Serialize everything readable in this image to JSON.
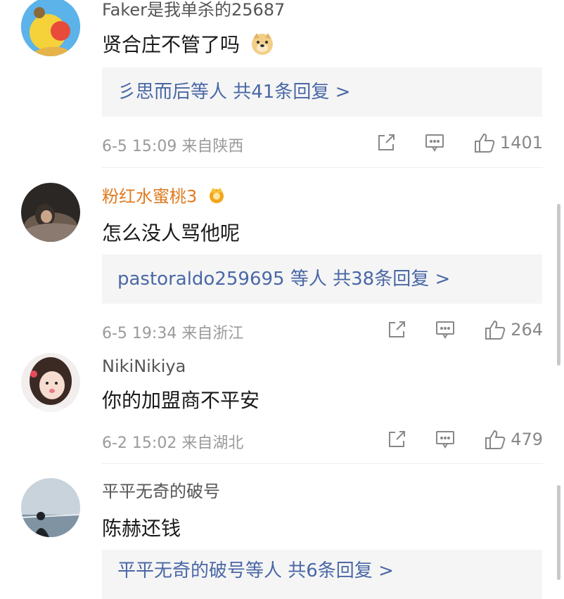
{
  "comments": [
    {
      "username": "Faker是我单杀的25687",
      "text": "贤合庄不管了吗",
      "emoji_icon": "doge-face-icon",
      "replies_label": "彡思而后等人 共41条回复 >",
      "time": "6-5 15:09",
      "location": "来自陕西",
      "likes": "1401"
    },
    {
      "username": "粉红水蜜桃3",
      "badge_icon": "crown-badge-icon",
      "text": "怎么没人骂他呢",
      "replies_label": "pastoraldo259695 等人 共38条回复 >",
      "time": "6-5 19:34",
      "location": "来自浙江",
      "likes": "264"
    },
    {
      "username": "NikiNikiya",
      "text": "你的加盟商不平安",
      "time": "6-2 15:02",
      "location": "来自湖北",
      "likes": "479"
    },
    {
      "username": "平平无奇的破号",
      "text": "陈赫还钱",
      "replies_label": "平平无奇的破号等人 共6条回复 >"
    }
  ],
  "colors": {
    "reply_link": "#4a68a6",
    "vip_name": "#e07a1f",
    "meta": "#9a9a9a"
  }
}
